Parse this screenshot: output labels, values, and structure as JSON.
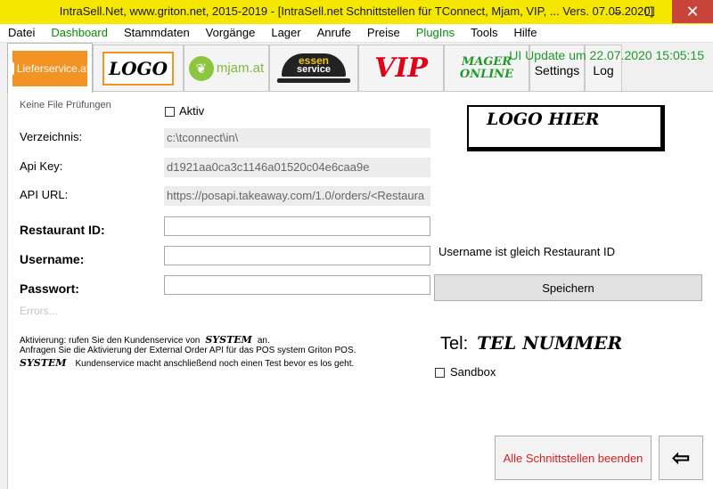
{
  "window": {
    "title": "IntraSell.Net, www.griton.net, 2015-2019 - [IntraSell.net Schnittstellen für TConnect, Mjam, VIP, ... Vers. 07.05.2020]",
    "minimize": "–",
    "maximize": "☐",
    "close": "✕"
  },
  "menu": [
    {
      "label": "Datei",
      "color": "#000000"
    },
    {
      "label": "Dashboard",
      "color": "#0a8a0a"
    },
    {
      "label": "Stammdaten",
      "color": "#000000"
    },
    {
      "label": "Vorgänge",
      "color": "#000000"
    },
    {
      "label": "Lager",
      "color": "#000000"
    },
    {
      "label": "Anrufe",
      "color": "#000000"
    },
    {
      "label": "Preise",
      "color": "#000000"
    },
    {
      "label": "PlugIns",
      "color": "#0a8a0a"
    },
    {
      "label": "Tools",
      "color": "#000000"
    },
    {
      "label": "Hilfe",
      "color": "#000000"
    }
  ],
  "tabs": {
    "lieferservice": "Lieferservice.at",
    "logo": "LOGO",
    "mjam": "mjam.at",
    "essen_top": "essen",
    "essen_bottom": "service",
    "vip": "VIP",
    "mager_top": "MAGER",
    "mager_bottom": "ONLINE",
    "settings": "Settings",
    "log": "Log"
  },
  "ui_update": "UI Update um 22.07.2020 15:05:15",
  "form": {
    "keine_file": "Keine File Prüfungen",
    "aktiv": "Aktiv",
    "verzeichnis_label": "Verzeichnis:",
    "verzeichnis_value": "c:\\tconnect\\in\\",
    "apikey_label": "Api Key:",
    "apikey_value": "d1921aa0ca3c1146a01520c04e6caa9e",
    "apiurl_label": "API URL:",
    "apiurl_value": "https://posapi.takeaway.com/1.0/orders/<Restaura",
    "restaurant_label": "Restaurant ID:",
    "restaurant_value": "",
    "username_label": "Username:",
    "username_value": "",
    "username_hint": "Username ist gleich Restaurant ID",
    "passwort_label": "Passwort:",
    "passwort_value": "",
    "speichern": "Speichern",
    "errors": "Errors..."
  },
  "logo_hier": "LOGO HIER",
  "tel_label": "Tel:",
  "tel_number": "TEL NUMMER",
  "sandbox": "Sandbox",
  "info": {
    "line1_a": "Aktivierung: rufen Sie den Kundenservice von",
    "line1_sys": "SYSTEM",
    "line1_b": "an.",
    "line2": "Anfragen Sie die Aktivierung der External Order API für das POS system Griton POS.",
    "line3_sys": "SYSTEM",
    "line3_b": "Kundenservice macht anschließend noch einen Test bevor es los geht."
  },
  "buttons": {
    "beenden": "Alle Schnittstellen beenden",
    "exit_icon": "⇦"
  }
}
